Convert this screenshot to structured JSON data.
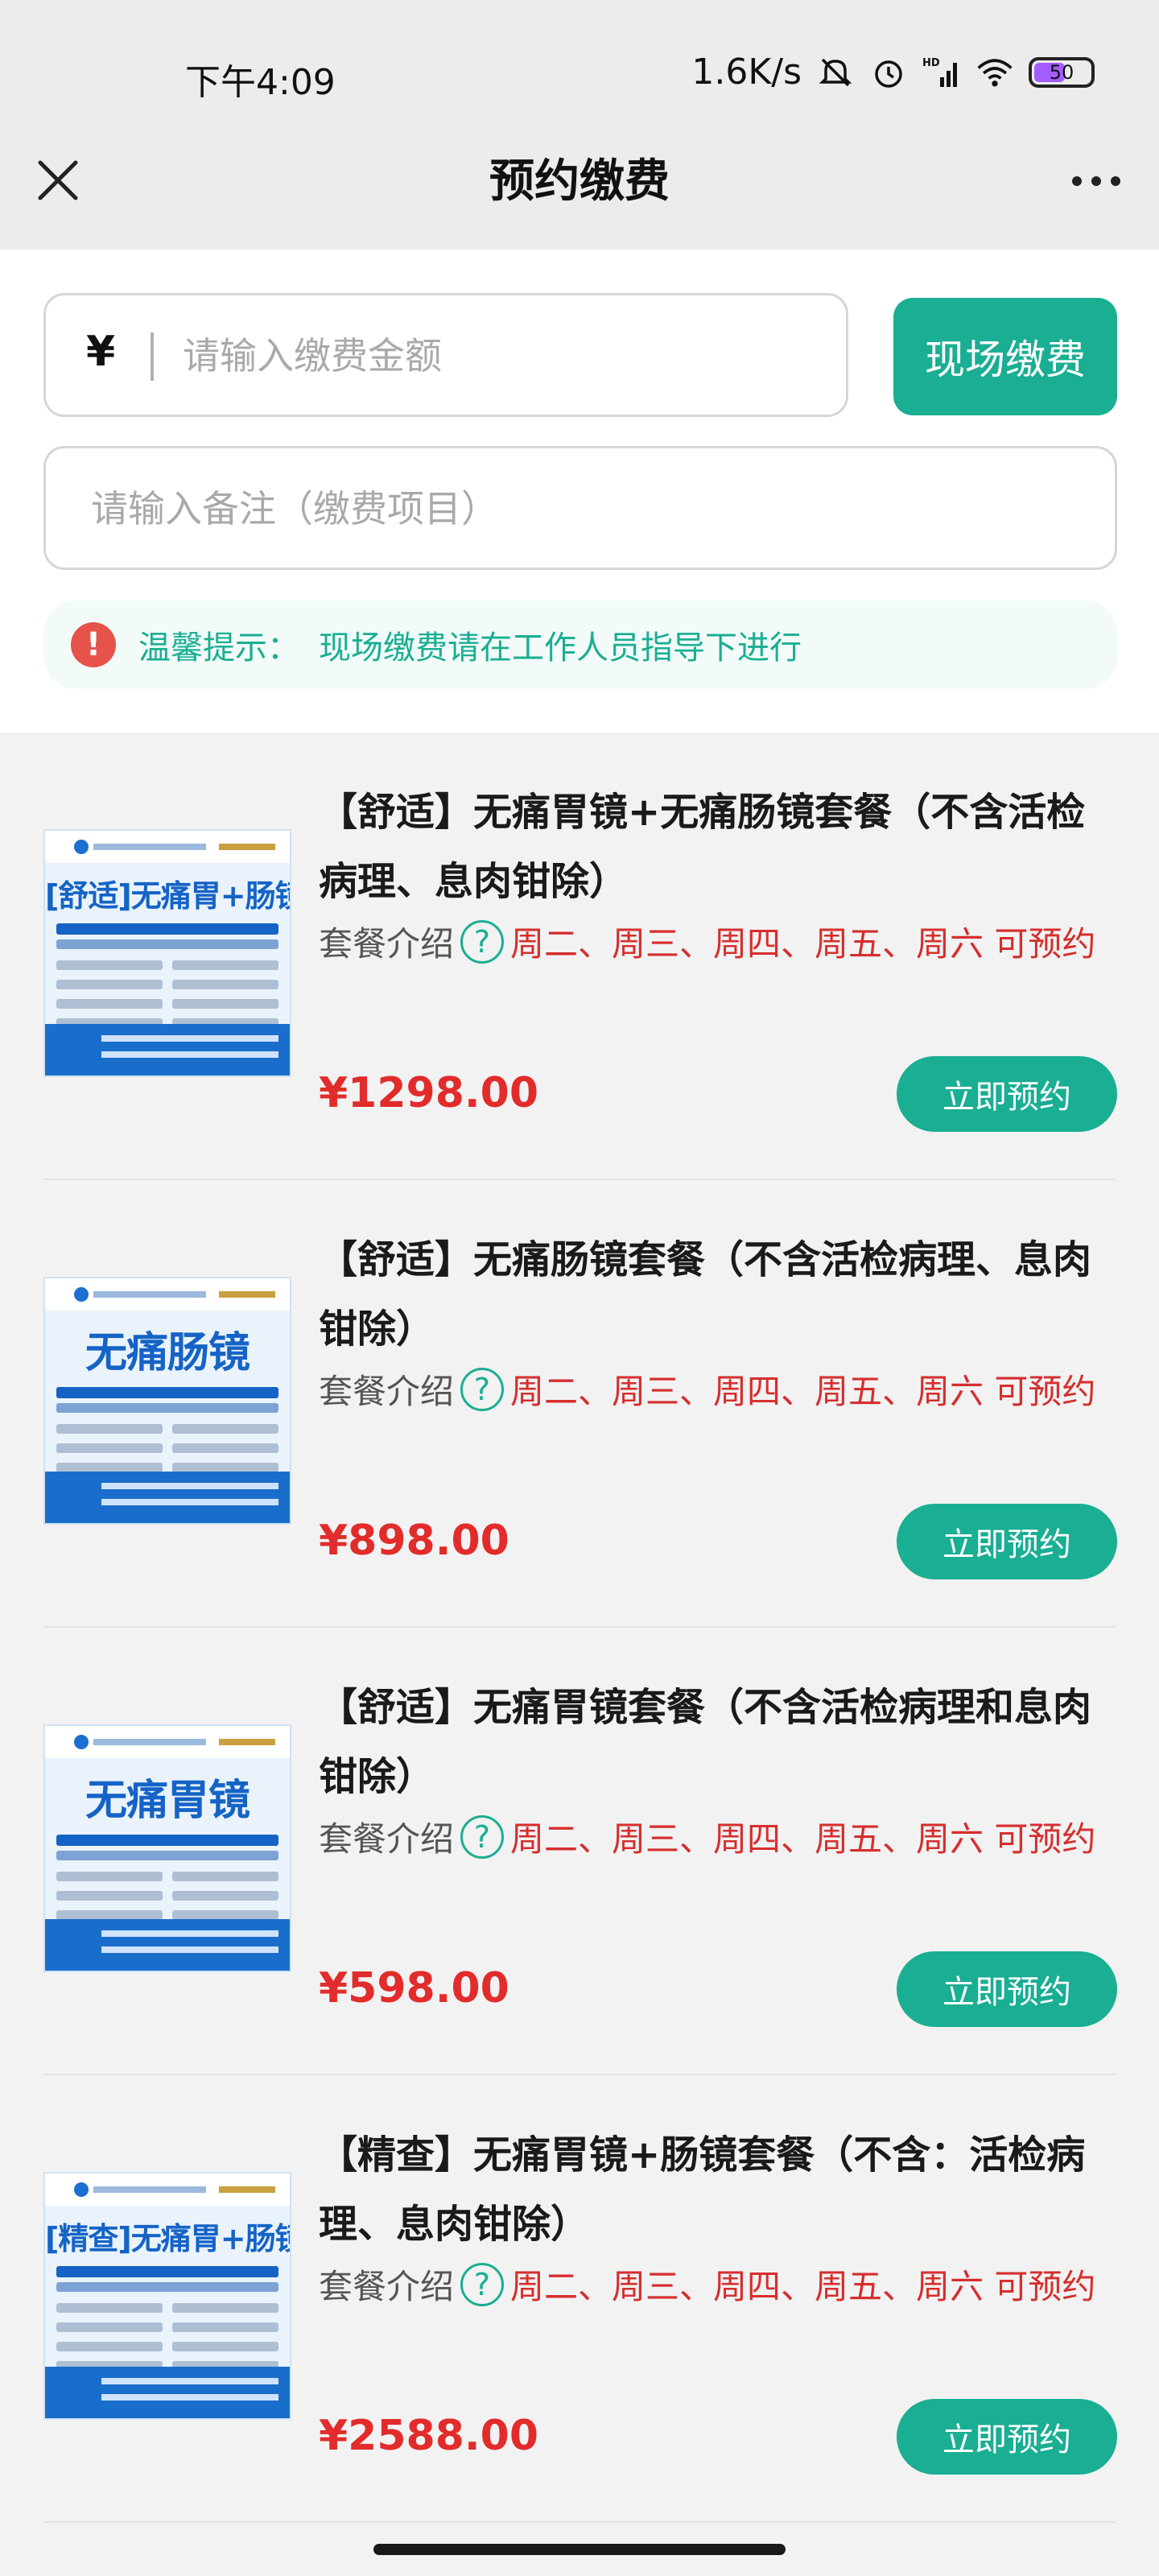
{
  "status_bar": {
    "time": "下午4:09",
    "speed": "1.6K/s",
    "battery": "50",
    "icons": [
      "mute-icon",
      "alarm-icon",
      "hd-signal-icon",
      "wifi-icon",
      "battery-icon"
    ]
  },
  "nav": {
    "title": "预约缴费",
    "close_icon": "close-icon",
    "more_icon": "more-icon"
  },
  "form": {
    "currency": "¥",
    "amount_placeholder": "请输入缴费金额",
    "pay_button": "现场缴费",
    "remark_placeholder": "请输入备注（缴费项目）",
    "notice_label": "温馨提示：",
    "notice_text": "现场缴费请在工作人员指导下进行"
  },
  "colors": {
    "accent": "#1aae93",
    "price": "#e22b2b",
    "days": "#d62e2e"
  },
  "packages": [
    {
      "title": "【舒适】无痛胃镜+无痛肠镜套餐（不含活检病理、息肉钳除）",
      "intro_label": "套餐介绍",
      "days": "周二、周三、周四、周五、周六 可预约",
      "price": "¥1298.00",
      "button": "立即预约",
      "thumb_title": "[舒适]无痛胃+肠镜"
    },
    {
      "title": "【舒适】无痛肠镜套餐（不含活检病理、息肉钳除）",
      "intro_label": "套餐介绍",
      "days": "周二、周三、周四、周五、周六 可预约",
      "price": "¥898.00",
      "button": "立即预约",
      "thumb_title": "无痛肠镜"
    },
    {
      "title": "【舒适】无痛胃镜套餐（不含活检病理和息肉钳除）",
      "intro_label": "套餐介绍",
      "days": "周二、周三、周四、周五、周六 可预约",
      "price": "¥598.00",
      "button": "立即预约",
      "thumb_title": "无痛胃镜"
    },
    {
      "title": "【精查】无痛胃镜+肠镜套餐（不含：活检病理、息肉钳除）",
      "intro_label": "套餐介绍",
      "days": "周二、周三、周四、周五、周六 可预约",
      "price": "¥2588.00",
      "button": "立即预约",
      "thumb_title": "[精查]无痛胃+肠镜"
    }
  ]
}
